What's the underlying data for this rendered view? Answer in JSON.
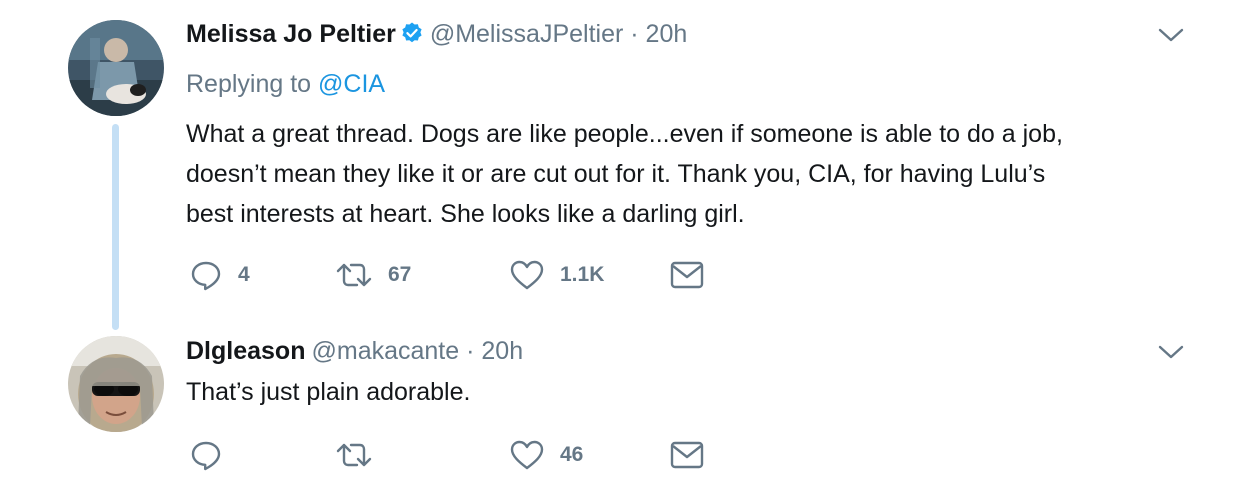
{
  "tweets": [
    {
      "display_name": "Melissa Jo Peltier",
      "verified": true,
      "handle": "@MelissaJPeltier",
      "separator": "·",
      "time": "20h",
      "replying_label": "Replying to",
      "replying_to": "@CIA",
      "text_lines": [
        "What a great thread.  Dogs are like people...even if someone is able to do a job,",
        "doesn’t mean they like it or are cut out for it.   Thank you, CIA, for having Lulu’s",
        "best interests at heart.  She looks like a darling girl."
      ],
      "counts": {
        "replies": "4",
        "retweets": "67",
        "likes": "1.1K"
      }
    },
    {
      "display_name": "Dlgleason",
      "verified": false,
      "handle": "@makacante",
      "separator": "·",
      "time": "20h",
      "text_lines": [
        "That’s just plain adorable."
      ],
      "counts": {
        "replies": "",
        "retweets": "",
        "likes": "46"
      }
    }
  ],
  "icons": {
    "reply": "reply-icon",
    "retweet": "retweet-icon",
    "like": "heart-icon",
    "dm": "envelope-icon",
    "menu": "chevron-down-icon",
    "verified": "verified-badge-icon"
  },
  "colors": {
    "text": "#14171a",
    "muted": "#657786",
    "link": "#1b95e0",
    "thread_line": "#c4dff5",
    "verified": "#1da1f2"
  }
}
